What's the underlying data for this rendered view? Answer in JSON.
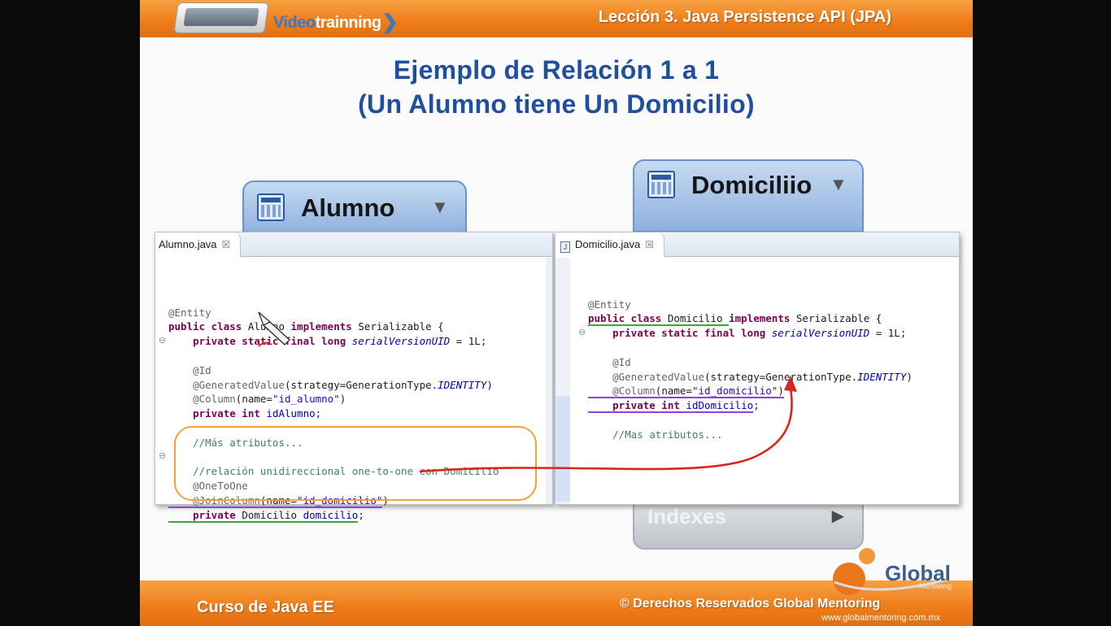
{
  "header": {
    "brand_part1": "Video",
    "brand_part2": "trainning",
    "lesson": "Lección 3. Java Persistence API (JPA)"
  },
  "title": {
    "line1": "Ejemplo de Relación  1 a 1",
    "line2": "(Un Alumno  tiene  Un Domicilio)"
  },
  "entities": {
    "alumno": "Alumno",
    "domicilio": "Domiciliio",
    "indexes": "Indexes"
  },
  "editor_left": {
    "tab": "Alumno.java",
    "close": "☒",
    "lines": {
      "l1": "@Entity",
      "l2a": "public class ",
      "l2b": "Alumno ",
      "l2c": "implements ",
      "l2d": "Serializable {",
      "l3a": "    private static final long ",
      "l3b": "serialVersionUID",
      "l3c": " = 1L;",
      "l4": "    @Id",
      "l5a": "    @GeneratedValue",
      "l5b": "(strategy=GenerationType.",
      "l5c": "IDENTITY",
      "l5d": ")",
      "l6a": "    @Column",
      "l6b": "(name=",
      "l6c": "\"id_alumno\"",
      "l6d": ")",
      "l7a": "    private int ",
      "l7b": "idAlumno",
      "l7c": ";",
      "l8": "    //Más atributos...",
      "l9": "    //relación unidireccional one-to-one con Domicilio",
      "l10": "    @OneToOne",
      "l11a": "    @JoinColumn",
      "l11b": "(name=",
      "l11c": "\"id_domicilio\"",
      "l11d": ")",
      "l12a": "    private ",
      "l12b": "Domicilio ",
      "l12c": "domicilio",
      "l12d": ";"
    }
  },
  "editor_right": {
    "tab": "Domicilio.java",
    "tab_icon": "J",
    "close": "☒",
    "lines": {
      "l1": "@Entity",
      "l2a": "public class ",
      "l2b": "Domicilio ",
      "l2c": "implements ",
      "l2d": "Serializable {",
      "l3a": "    private static final long ",
      "l3b": "serialVersionUID",
      "l3c": " = 1L;",
      "l4": "    @Id",
      "l5a": "    @GeneratedValue",
      "l5b": "(strategy=GenerationType.",
      "l5c": "IDENTITY",
      "l5d": ")",
      "l6a": "    @Column",
      "l6b": "(name=",
      "l6c": "\"id_domicilio\"",
      "l6d": ")",
      "l7a": "    private int ",
      "l7b": "idDomicilio",
      "l7c": ";",
      "l8": "    //Mas atributos..."
    }
  },
  "footer": {
    "course": "Curso  de Java EE",
    "rights": "© Derechos Reservados Global Mentoring",
    "url": "www.globalmentoring.com.mx"
  },
  "logo": {
    "name": "Global",
    "sub": "Mentoring"
  },
  "colors": {
    "orange": "#ee7c18",
    "title_blue": "#1f4fa0",
    "arrow_red": "#d8261c",
    "ring_orange": "#f2a03c"
  }
}
